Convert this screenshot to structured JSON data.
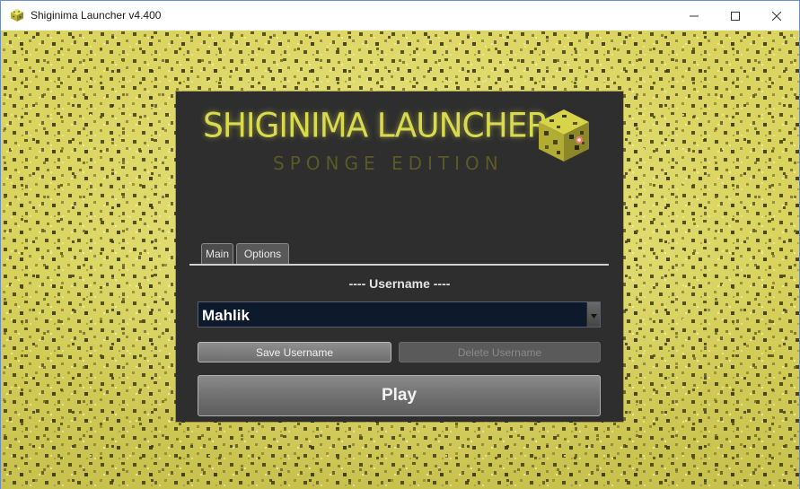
{
  "window": {
    "title": "Shiginima Launcher v4.400"
  },
  "logo": {
    "title": "SHIGINIMA LAUNCHER",
    "subtitle": "SPONGE EDITION"
  },
  "tabs": [
    {
      "label": "Main",
      "selected": true
    },
    {
      "label": "Options",
      "selected": false
    }
  ],
  "main": {
    "username_heading": "---- Username ----",
    "username_value": "Mahlik",
    "save_label": "Save Username",
    "delete_label": "Delete Username",
    "play_label": "Play"
  },
  "colors": {
    "background": "#d8d15e",
    "panel": "#2e2e2e",
    "logo_accent": "#d9da4e",
    "username_field": "#0e1a2c"
  },
  "icons": {
    "app": "sponge-block-icon",
    "minimize": "minimize-icon",
    "maximize": "maximize-icon",
    "close": "close-icon",
    "dropdown": "chevron-down-icon"
  }
}
